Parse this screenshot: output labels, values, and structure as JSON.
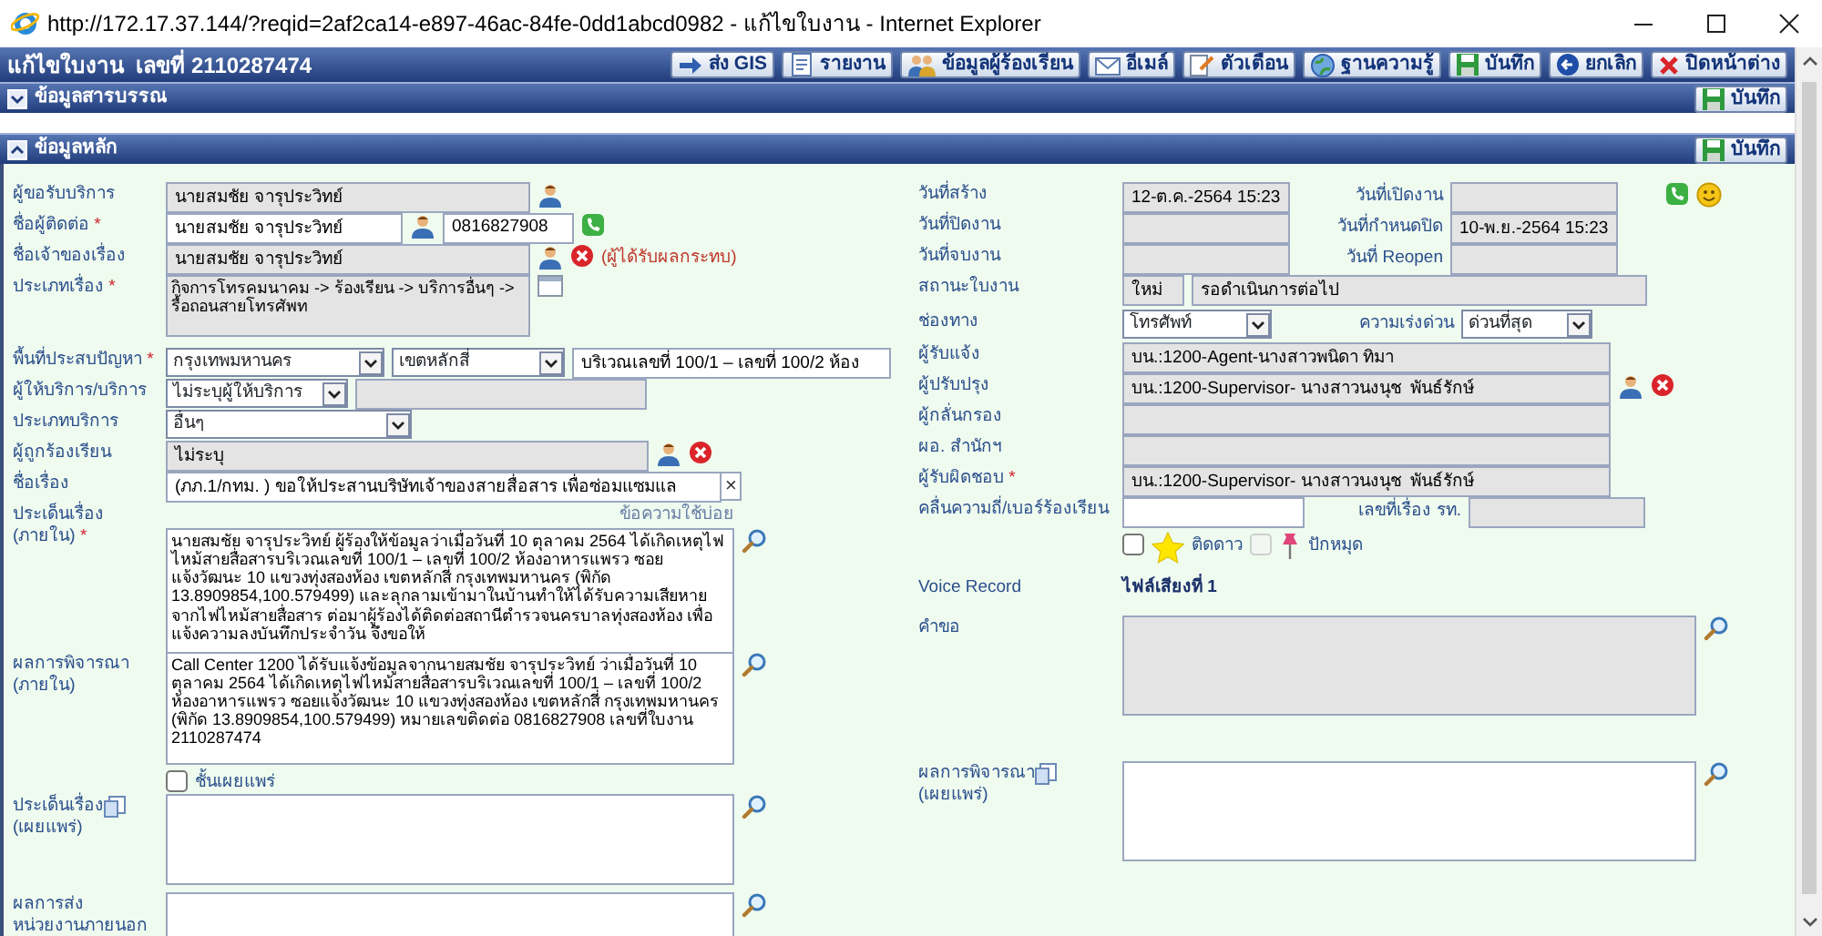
{
  "window": {
    "title": "http://172.17.37.144/?reqid=2af2ca14-e897-46ac-84fe-0dd1abcd0982 - แก้ไขใบงาน - Internet Explorer"
  },
  "header": {
    "title": "แก้ไขใบงาน  เลขที่ 2110287474",
    "buttons": [
      "ส่ง GIS",
      "รายงาน",
      "ข้อมูลผู้ร้องเรียน",
      "อีเมล์",
      "ตัวเตือน",
      "ฐานความรู้",
      "บันทึก",
      "ยกเลิก",
      "ปิดหน้าต่าง"
    ]
  },
  "sections": [
    {
      "title": "ข้อมูลสารบรรณ",
      "button": "บันทึก",
      "expanded": false
    },
    {
      "title": "ข้อมูลหลัก",
      "button": "บันทึก",
      "expanded": true
    }
  ],
  "left_rows": [
    {
      "label": "ผู้ขอรับบริการ",
      "fields": [
        {
          "kind": "input",
          "value": "นายสมชัย จารุประวิทย์",
          "readonly": true
        }
      ]
    },
    {
      "label": "ชื่อผู้ติดต่อ",
      "required_mark": "*",
      "fields": [
        {
          "kind": "input",
          "value": "นายสมชัย จารุประวิทย์",
          "readonly": false
        },
        {
          "kind": "input",
          "value": "0816827908",
          "readonly": false
        }
      ]
    },
    {
      "label": "ชื่อเจ้าของเรื่อง",
      "fields": [
        {
          "kind": "input",
          "value": "นายสมชัย จารุประวิทย์",
          "readonly": true
        },
        {
          "kind": "note",
          "text": "(ผู้ได้รับผลกระทบ)"
        }
      ]
    },
    {
      "label": "ประเภทเรื่อง",
      "required_mark": "*",
      "fields": [
        {
          "kind": "textarea",
          "value": "กิจการโทรคมนาคม -> ร้องเรียน -> บริการอื่นๆ -> รื้อถอนสายโทรศัพท",
          "readonly": true
        }
      ]
    },
    {
      "label": "พื้นที่ประสบปัญหา",
      "required_mark": "*",
      "fields": [
        {
          "kind": "select",
          "value": "กรุงเทพมหานคร"
        },
        {
          "kind": "select",
          "value": "เขตหลักสี่"
        },
        {
          "kind": "input",
          "value": "บริเวณเลขที่ 100/1 – เลขที่ 100/2 ห้อง",
          "readonly": false
        }
      ]
    },
    {
      "label": "ผู้ให้บริการ/บริการ",
      "fields": [
        {
          "kind": "select",
          "value": "ไม่ระบุผู้ให้บริการ"
        },
        {
          "kind": "input",
          "readonly": true
        }
      ]
    },
    {
      "label": "ประเภทบริการ",
      "fields": [
        {
          "kind": "select",
          "value": "อื่นๆ"
        }
      ]
    },
    {
      "label": "ผู้ถูกร้องเรียน",
      "fields": [
        {
          "kind": "input",
          "value": "ไม่ระบุ",
          "readonly": true
        }
      ]
    },
    {
      "label": "ชื่อเรื่อง",
      "fields": [
        {
          "kind": "input",
          "value": "(ภภ.1/กทม. ) ขอให้ประสานบริษัทเจ้าของสายสื่อสาร เพื่อซ่อมแซมแล",
          "readonly": false
        },
        {
          "kind": "clear_text",
          "text": "×"
        }
      ]
    },
    {
      "label_lines": [
        "ประเด็นเรื่อง",
        "(ภายใน)"
      ],
      "required_mark": "*",
      "link": "ข้อความใช้บ่อย",
      "fields": [
        {
          "kind": "textarea",
          "value": "นายสมชัย จารุประวิทย์ ผู้ร้องให้ข้อมูลว่าเมื่อวันที่ 10 ตุลาคม 2564 ได้เกิดเหตุไฟไหม้สายสื่อสารบริเวณเลขที่ 100/1 – เลขที่ 100/2 ห้องอาหารแพรว ซอยแจ้งวัฒนะ 10 แขวงทุ่งสองห้อง เขตหลักสี่ กรุงเทพมหานคร (พิกัด 13.8909854,100.579499) และลุกลามเข้ามาในบ้านทำให้ได้รับความเสียหายจากไฟไหม้สายสื่อสาร ต่อมาผู้ร้องได้ติดต่อสถานีตำรวจนครบาลทุ่งสองห้อง เพื่อแจ้งความลงบันทึกประจำวัน จึงขอให้",
          "readonly": false
        }
      ]
    },
    {
      "label_lines": [
        "ผลการพิจารณา",
        "(ภายใน)"
      ],
      "fields": [
        {
          "kind": "textarea",
          "value": "Call Center 1200 ได้รับแจ้งข้อมูลจากนายสมชัย จารุประวิทย์ ว่าเมื่อวันที่ 10 ตุลาคม 2564 ได้เกิดเหตุไฟไหม้สายสื่อสารบริเวณเลขที่ 100/1 – เลขที่ 100/2 ห้องอาหารแพรว ซอยแจ้งวัฒนะ 10 แขวงทุ่งสองห้อง เขตหลักสี่ กรุงเทพมหานคร (พิกัด 13.8909854,100.579499) หมายเลขติดต่อ 0816827908 เลขที่ใบงาน 2110287474",
          "readonly": false
        }
      ]
    },
    {
      "fields": [
        {
          "kind": "checkbox",
          "checked": false,
          "disabled": false
        },
        {
          "kind": "text",
          "text": "ชั้นเผยแพร่"
        }
      ]
    },
    {
      "label_lines": [
        "ประเด็นเรื่อง",
        "(เผยแพร่)"
      ],
      "fields": [
        {
          "kind": "textarea",
          "readonly": false
        }
      ]
    },
    {
      "label_lines": [
        "ผลการส่ง",
        "หน่วยงานภายนอก"
      ],
      "fields": [
        {
          "kind": "textarea",
          "readonly": false
        }
      ]
    }
  ],
  "right_rows": [
    {
      "label": "วันที่สร้าง",
      "fields": [
        {
          "kind": "input",
          "value": "12-ต.ค.-2564 15:23",
          "readonly": true
        },
        {
          "kind": "label",
          "text": "วันที่เปิดงาน"
        },
        {
          "kind": "input",
          "readonly": true
        }
      ]
    },
    {
      "label": "วันที่ปิดงาน",
      "fields": [
        {
          "kind": "input",
          "readonly": true
        },
        {
          "kind": "label",
          "text": "วันที่กำหนดปิด"
        },
        {
          "kind": "input",
          "value": "10-พ.ย.-2564 15:23",
          "readonly": true
        }
      ]
    },
    {
      "label": "วันที่จบงาน",
      "fields": [
        {
          "kind": "input",
          "readonly": true
        },
        {
          "kind": "label",
          "text": "วันที่ Reopen"
        },
        {
          "kind": "input",
          "readonly": true
        }
      ]
    },
    {
      "label": "สถานะใบงาน",
      "fields": [
        {
          "kind": "input",
          "value": "ใหม่",
          "readonly": true
        },
        {
          "kind": "input",
          "value": "รอดำเนินการต่อไป",
          "readonly": true
        }
      ]
    },
    {
      "label": "ช่องทาง",
      "fields": [
        {
          "kind": "select",
          "value": "โทรศัพท์"
        },
        {
          "kind": "label",
          "text": "ความเร่งด่วน"
        },
        {
          "kind": "select",
          "value": "ด่วนที่สุด"
        }
      ]
    },
    {
      "label": "ผู้รับแจ้ง",
      "fields": [
        {
          "kind": "input",
          "value": "บน.:1200-Agent-นางสาวพนิดา ทิมา",
          "readonly": true
        }
      ]
    },
    {
      "label": "ผู้ปรับปรุง",
      "fields": [
        {
          "kind": "input",
          "value": "บน.:1200-Supervisor- นางสาวนงนุช  พันธ์รักษ์",
          "readonly": true
        }
      ]
    },
    {
      "label": "ผู้กลั่นกรอง",
      "fields": [
        {
          "kind": "input",
          "readonly": true
        }
      ]
    },
    {
      "label": "ผอ. สำนักฯ",
      "fields": [
        {
          "kind": "input",
          "readonly": true
        }
      ]
    },
    {
      "label": "ผู้รับผิดชอบ",
      "required_mark": "*",
      "fields": [
        {
          "kind": "input",
          "value": "บน.:1200-Supervisor- นางสาวนงนุช  พันธ์รักษ์",
          "readonly": true
        }
      ]
    },
    {
      "label": "คลื่นความถี่/เบอร์ร้องเรียน",
      "fields": [
        {
          "kind": "input",
          "readonly": false
        },
        {
          "kind": "label",
          "text": "เลขที่เรื่อง รท."
        },
        {
          "kind": "input",
          "readonly": true
        }
      ]
    },
    {
      "fields": [
        {
          "kind": "checkbox",
          "checked": false,
          "disabled": false
        },
        {
          "kind": "text",
          "text": "ติดดาว"
        },
        {
          "kind": "checkbox",
          "checked": false,
          "disabled": true
        },
        {
          "kind": "text",
          "text": "ปักหมุด"
        }
      ]
    },
    {
      "label": "Voice Record",
      "fields": [
        {
          "kind": "link",
          "text": "ไฟล์เสียงที่ 1"
        }
      ]
    },
    {
      "label": "คำขอ",
      "fields": [
        {
          "kind": "textarea",
          "readonly": true
        }
      ]
    },
    {
      "label_lines": [
        "ผลการพิจารณา",
        "(เผยแพร่)"
      ],
      "fields": [
        {
          "kind": "textarea",
          "readonly": false
        }
      ]
    }
  ]
}
